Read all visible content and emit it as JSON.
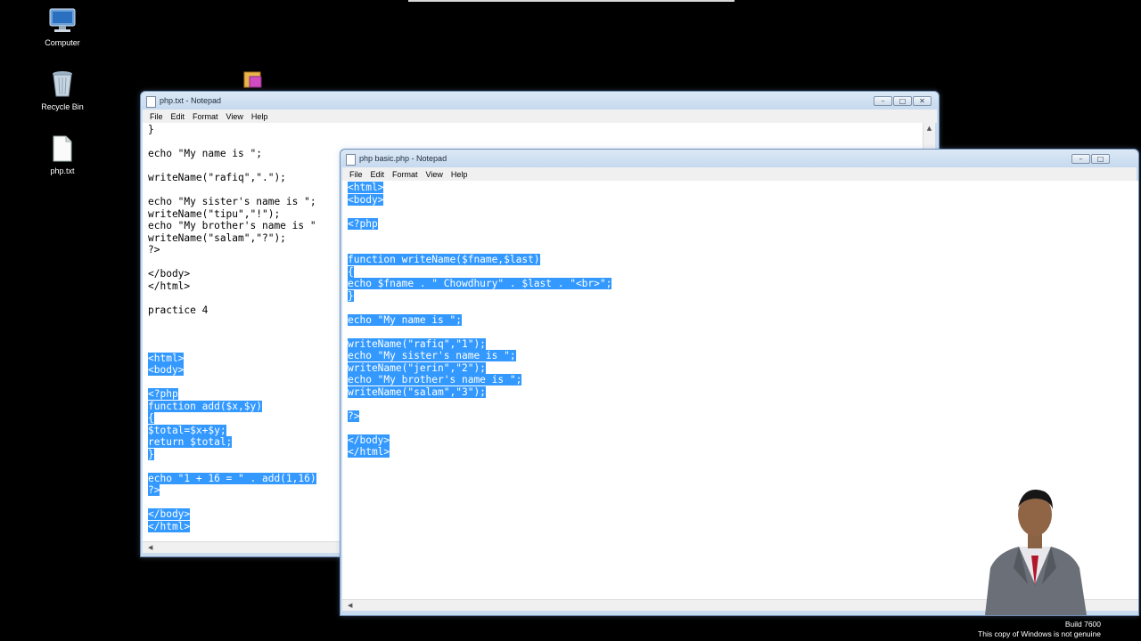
{
  "desktop": {
    "icons": [
      {
        "name": "computer-icon",
        "label": "Computer"
      },
      {
        "name": "recycle-bin-icon",
        "label": "Recycle Bin"
      },
      {
        "name": "text-file-icon",
        "label": "php.txt"
      }
    ]
  },
  "back_window": {
    "title": "php.txt - Notepad",
    "menu": [
      "File",
      "Edit",
      "Format",
      "View",
      "Help"
    ],
    "lines": [
      {
        "text": "}",
        "hl": false
      },
      {
        "text": "",
        "hl": false
      },
      {
        "text": "echo \"My name is \";",
        "hl": false
      },
      {
        "text": "",
        "hl": false
      },
      {
        "text": "writeName(\"rafiq\",\".\");",
        "hl": false
      },
      {
        "text": "",
        "hl": false
      },
      {
        "text": "echo \"My sister's name is \";",
        "hl": false
      },
      {
        "text": "writeName(\"tipu\",\"!\");",
        "hl": false
      },
      {
        "text": "echo \"My brother's name is \"",
        "hl": false
      },
      {
        "text": "writeName(\"salam\",\"?\");",
        "hl": false
      },
      {
        "text": "?>",
        "hl": false
      },
      {
        "text": "",
        "hl": false
      },
      {
        "text": "</body>",
        "hl": false
      },
      {
        "text": "</html>",
        "hl": false
      },
      {
        "text": "",
        "hl": false
      },
      {
        "text": "practice 4",
        "hl": false
      },
      {
        "text": "",
        "hl": false
      },
      {
        "text": "",
        "hl": false
      },
      {
        "text": "",
        "hl": false
      },
      {
        "text": "<html>",
        "hl": true
      },
      {
        "text": "<body>",
        "hl": true
      },
      {
        "text": "",
        "hl": false
      },
      {
        "text": "<?php",
        "hl": true
      },
      {
        "text": "function add($x,$y)",
        "hl": true
      },
      {
        "text": "{",
        "hl": true
      },
      {
        "text": "$total=$x+$y;",
        "hl": true
      },
      {
        "text": "return $total;",
        "hl": true
      },
      {
        "text": "}",
        "hl": true
      },
      {
        "text": "",
        "hl": false
      },
      {
        "text": "echo \"1 + 16 = \" . add(1,16)",
        "hl": true
      },
      {
        "text": "?>",
        "hl": true
      },
      {
        "text": "",
        "hl": false
      },
      {
        "text": "</body>",
        "hl": true
      },
      {
        "text": "</html>",
        "hl": true
      }
    ]
  },
  "front_window": {
    "title": "php basic.php - Notepad",
    "menu": [
      "File",
      "Edit",
      "Format",
      "View",
      "Help"
    ],
    "lines": [
      {
        "text": "<html>",
        "hl": true
      },
      {
        "text": "<body>",
        "hl": true
      },
      {
        "text": "",
        "hl": false
      },
      {
        "text": "<?php",
        "hl": true
      },
      {
        "text": "",
        "hl": false
      },
      {
        "text": "",
        "hl": false
      },
      {
        "text": "function writeName($fname,$last)",
        "hl": true
      },
      {
        "text": "{",
        "hl": true
      },
      {
        "text": "echo $fname . \" Chowdhury\" . $last . \"<br>\";",
        "hl": true
      },
      {
        "text": "}",
        "hl": true
      },
      {
        "text": "",
        "hl": false
      },
      {
        "text": "echo \"My name is \";",
        "hl": true
      },
      {
        "text": "",
        "hl": false
      },
      {
        "text": "writeName(\"rafiq\",\"1\");",
        "hl": true
      },
      {
        "text": "echo \"My sister's name is \";",
        "hl": true
      },
      {
        "text": "writeName(\"jerin\",\"2\");",
        "hl": true
      },
      {
        "text": "echo \"My brother's name is \";",
        "hl": true
      },
      {
        "text": "writeName(\"salam\",\"3\");",
        "hl": true
      },
      {
        "text": "",
        "hl": false
      },
      {
        "text": "?>",
        "hl": true
      },
      {
        "text": "",
        "hl": false
      },
      {
        "text": "</body>",
        "hl": true
      },
      {
        "text": "</html>",
        "hl": true
      }
    ]
  },
  "watermark": {
    "build": "Build 7600",
    "notice": "This copy of Windows is not genuine"
  },
  "colors": {
    "selection": "#3399ff",
    "desktop": "#000000",
    "window_frame": "#c9dbef"
  }
}
